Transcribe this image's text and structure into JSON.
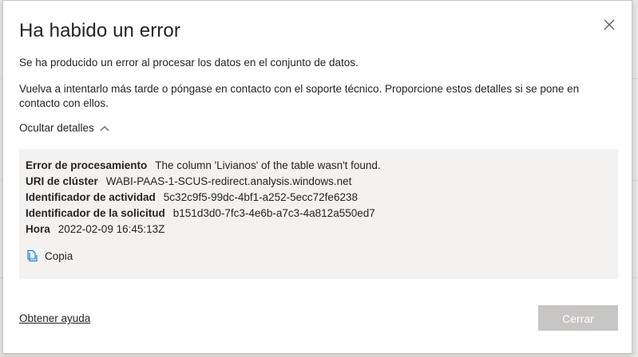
{
  "dialog": {
    "title": "Ha habido un error",
    "message_1": "Se ha producido un error al procesar los datos en el conjunto de datos.",
    "message_2": "Vuelva a intentarlo más tarde o póngase en contacto con el soporte técnico. Proporcione estos detalles si se pone en contacto con ellos.",
    "toggle_label": "Ocultar detalles",
    "details": [
      {
        "label": "Error de procesamiento",
        "value": "The column 'Livianos' of the table wasn't found."
      },
      {
        "label": "URI de clúster",
        "value": "WABI-PAAS-1-SCUS-redirect.analysis.windows.net"
      },
      {
        "label": "Identificador de actividad",
        "value": "5c32c9f5-99dc-4bf1-a252-5ecc72fe6238"
      },
      {
        "label": "Identificador de la solicitud",
        "value": "b151d3d0-7fc3-4e6b-a7c3-4a812a550ed7"
      },
      {
        "label": "Hora",
        "value": "2022-02-09 16:45:13Z"
      }
    ],
    "copy_label": "Copia",
    "help_link": "Obtener ayuda",
    "close_button": "Cerrar",
    "icons": {
      "close": "close-icon",
      "chevron": "chevron-up-icon",
      "copy": "copy-icon"
    },
    "colors": {
      "accent": "#0078d4",
      "disabled_button": "#c8c6c4",
      "details_bg": "#f3f2f1"
    }
  }
}
